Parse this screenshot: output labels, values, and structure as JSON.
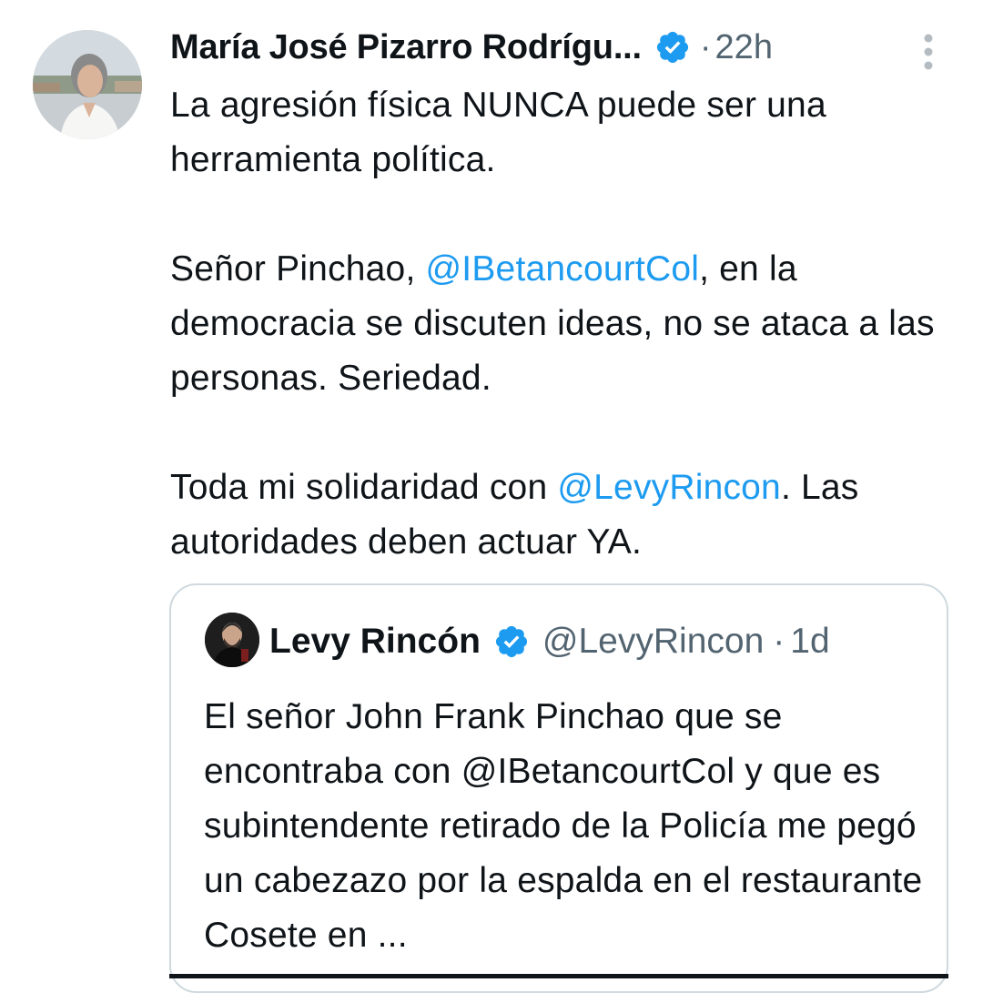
{
  "tweet": {
    "author_name": "María José Pizarro Rodrígu...",
    "separator": "·",
    "time": "22h",
    "paragraphs": [
      {
        "before": "La agresión física NUNCA puede ser una herramienta política.",
        "mention": "",
        "after": ""
      },
      {
        "before": "Señor Pinchao, ",
        "mention": "@IBetancourtCol",
        "after": ", en la democracia se discuten ideas, no se ataca a las personas. Seriedad."
      },
      {
        "before": "Toda mi solidaridad con ",
        "mention": "@LevyRincon",
        "after": ". Las autoridades deben actuar YA."
      }
    ]
  },
  "quote": {
    "author_name": "Levy Rincón",
    "handle": "@LevyRincon",
    "separator": "·",
    "time": "1d",
    "text": "El señor John Frank Pinchao que se encontraba con @IBetancourtCol  y que es subintendente retirado de la Policía me pegó un cabezazo por la espalda en el restaurante Cosete en ..."
  },
  "icons": {
    "verified": "verified-badge-icon",
    "more": "more-vertical-icon"
  },
  "colors": {
    "accent": "#1d9bf0",
    "text": "#0f1419",
    "secondary": "#536471",
    "border": "#cfd9de"
  }
}
